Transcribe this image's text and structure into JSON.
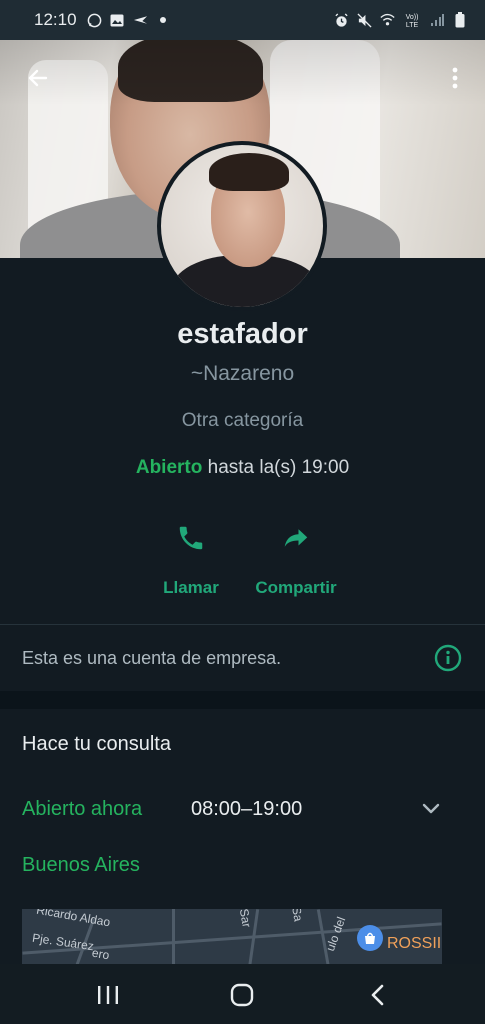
{
  "status_bar": {
    "time": "12:10",
    "left_icons": [
      "whatsapp-icon",
      "gallery-icon",
      "carrier-icon",
      "dot-icon"
    ],
    "right_icons": [
      "alarm-icon",
      "mute-icon",
      "wifi-icon",
      "volte-icon",
      "signal-icon",
      "battery-icon"
    ],
    "volte_label": "Vo)) LTE"
  },
  "header": {
    "back_icon": "arrow-left-icon",
    "menu_icon": "more-vert-icon"
  },
  "profile": {
    "name": "estafador",
    "push_name": "~Nazareno",
    "category": "Otra categoría",
    "open_label": "Abierto",
    "hours_suffix": "hasta la(s) 19:00"
  },
  "actions": [
    {
      "label": "Llamar",
      "icon": "phone-icon"
    },
    {
      "label": "Compartir",
      "icon": "share-icon"
    }
  ],
  "business_notice": {
    "text": "Esta es una cuenta de empresa.",
    "icon": "info-icon"
  },
  "details": {
    "title": "Hace tu consulta",
    "open_now": "Abierto ahora",
    "hours_range": "08:00–19:00",
    "city": "Buenos Aires"
  },
  "map": {
    "labels": [
      "Ricardo Aldao",
      "Pje. Suárez",
      "Sar",
      "Sa",
      "ulo del",
      "ero"
    ],
    "poi": "ROSSII"
  },
  "colors": {
    "accent_green": "#25b35f",
    "teal": "#21a87a",
    "background": "#121b22"
  },
  "nav_bar": {
    "icons": [
      "recent-apps-icon",
      "home-icon",
      "back-icon"
    ]
  }
}
